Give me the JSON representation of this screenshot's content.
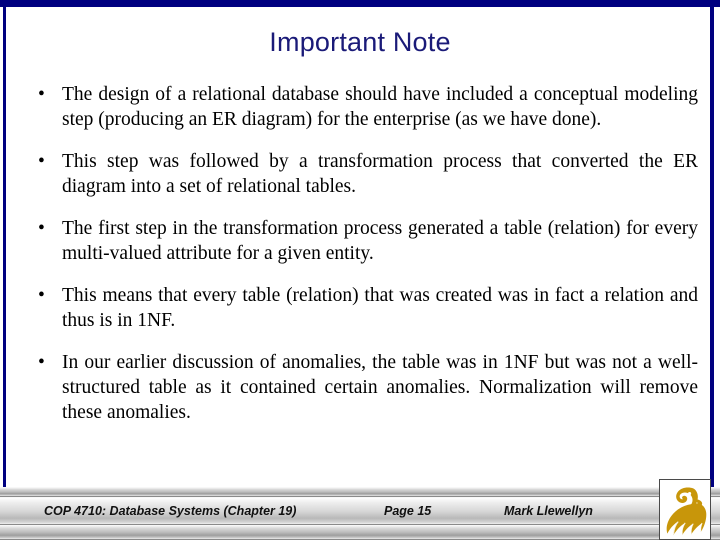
{
  "slide": {
    "title": "Important Note",
    "title_color": "#1a1a78",
    "accent_color": "#000080",
    "background_color": "#ffffff",
    "bullet_marker": "•",
    "bullets": [
      "The design of a relational database should have included a conceptual modeling step (producing an ER diagram) for the enterprise (as we have done).",
      "This step was followed by a transformation process that converted the ER diagram into a set of relational tables.",
      "The first step in the transformation process generated a table (relation) for every multi-valued attribute for a given entity.",
      "This means that every table (relation) that was created was in fact a relation and thus is in 1NF.",
      "In our earlier discussion of anomalies, the table was in 1NF but was not a well-structured table as it contained certain anomalies. Normalization will remove these anomalies."
    ]
  },
  "footer": {
    "course": "COP 4710: Database Systems  (Chapter 19)",
    "page": "Page 15",
    "author": "Mark Llewellyn",
    "logo_name": "ucf-pegasus-logo",
    "logo_color": "#c8960a"
  }
}
